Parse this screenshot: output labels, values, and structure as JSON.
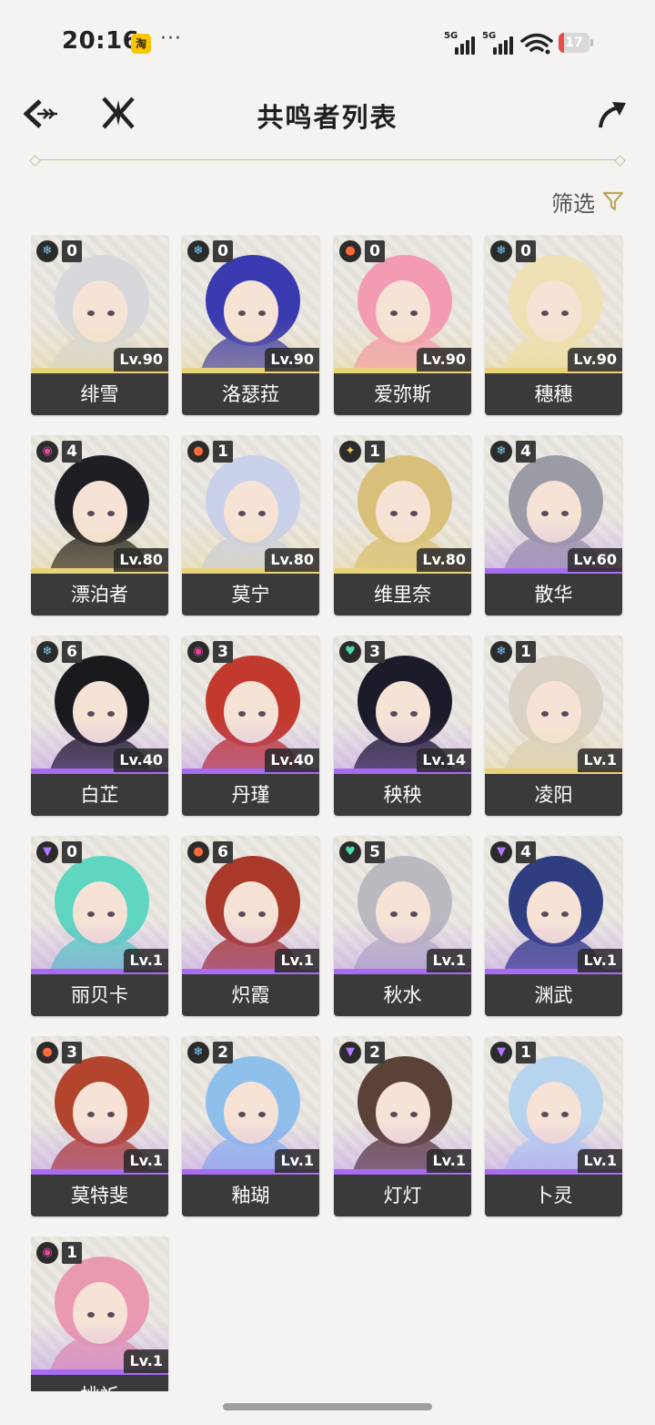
{
  "status_bar": {
    "time": "20:16",
    "app_badge": "淘",
    "more": "···",
    "sim1": "5G",
    "sim2": "5G",
    "battery": "17",
    "battery_level": 0.17
  },
  "header": {
    "title": "共鸣者列表"
  },
  "filter": {
    "label": "筛选"
  },
  "colors": {
    "accent": "#c8b878",
    "card_name_bg": "#3a3a3a",
    "five_star_glow": "#e8d27a",
    "four_star_glow": "#a86cf0"
  },
  "characters": [
    {
      "name": "绯雪",
      "level": "Lv.90",
      "sequence": "0",
      "element": "glacio",
      "rarity": 5
    },
    {
      "name": "洛瑟菈",
      "level": "Lv.90",
      "sequence": "0",
      "element": "glacio",
      "rarity": 5
    },
    {
      "name": "爱弥斯",
      "level": "Lv.90",
      "sequence": "0",
      "element": "fusion",
      "rarity": 5
    },
    {
      "name": "穗穗",
      "level": "Lv.90",
      "sequence": "0",
      "element": "glacio",
      "rarity": 5
    },
    {
      "name": "漂泊者",
      "level": "Lv.80",
      "sequence": "4",
      "element": "havoc",
      "rarity": 5
    },
    {
      "name": "莫宁",
      "level": "Lv.80",
      "sequence": "1",
      "element": "fusion",
      "rarity": 5
    },
    {
      "name": "维里奈",
      "level": "Lv.80",
      "sequence": "1",
      "element": "spectro",
      "rarity": 5
    },
    {
      "name": "散华",
      "level": "Lv.60",
      "sequence": "4",
      "element": "glacio",
      "rarity": 4
    },
    {
      "name": "白芷",
      "level": "Lv.40",
      "sequence": "6",
      "element": "glacio",
      "rarity": 4
    },
    {
      "name": "丹瑾",
      "level": "Lv.40",
      "sequence": "3",
      "element": "havoc",
      "rarity": 4
    },
    {
      "name": "秧秧",
      "level": "Lv.14",
      "sequence": "3",
      "element": "aero",
      "rarity": 4
    },
    {
      "name": "凌阳",
      "level": "Lv.1",
      "sequence": "1",
      "element": "glacio",
      "rarity": 5
    },
    {
      "name": "丽贝卡",
      "level": "Lv.1",
      "sequence": "0",
      "element": "electro",
      "rarity": 4
    },
    {
      "name": "炽霞",
      "level": "Lv.1",
      "sequence": "6",
      "element": "fusion",
      "rarity": 4
    },
    {
      "name": "秋水",
      "level": "Lv.1",
      "sequence": "5",
      "element": "aero",
      "rarity": 4
    },
    {
      "name": "渊武",
      "level": "Lv.1",
      "sequence": "4",
      "element": "electro",
      "rarity": 4
    },
    {
      "name": "莫特斐",
      "level": "Lv.1",
      "sequence": "3",
      "element": "fusion",
      "rarity": 4
    },
    {
      "name": "釉瑚",
      "level": "Lv.1",
      "sequence": "2",
      "element": "glacio",
      "rarity": 4
    },
    {
      "name": "灯灯",
      "level": "Lv.1",
      "sequence": "2",
      "element": "electro",
      "rarity": 4
    },
    {
      "name": "卜灵",
      "level": "Lv.1",
      "sequence": "1",
      "element": "electro",
      "rarity": 4
    },
    {
      "name": "桃祈",
      "level": "Lv.1",
      "sequence": "1",
      "element": "havoc",
      "rarity": 4
    }
  ]
}
